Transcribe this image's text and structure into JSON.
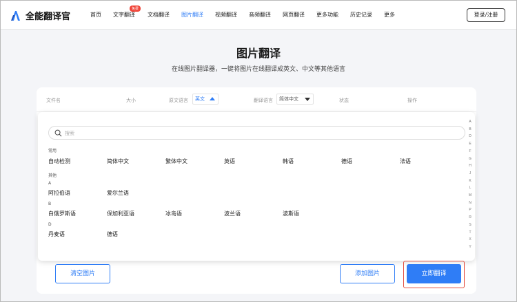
{
  "header": {
    "logo_text": "全能翻译官",
    "nav": [
      {
        "label": "首页",
        "active": false
      },
      {
        "label": "文字翻译",
        "active": false
      },
      {
        "label": "文档翻译",
        "active": false
      },
      {
        "label": "图片翻译",
        "active": true
      },
      {
        "label": "视频翻译",
        "active": false
      },
      {
        "label": "音频翻译",
        "active": false
      },
      {
        "label": "网页翻译",
        "active": false
      },
      {
        "label": "更多功能",
        "active": false
      },
      {
        "label": "历史记录",
        "active": false
      },
      {
        "label": "更多",
        "active": false
      }
    ],
    "free_badge": "免费",
    "login_label": "登录/注册"
  },
  "main": {
    "title": "图片翻译",
    "subtitle": "在线图片翻译器，一键将图片在线翻译成英文、中文等其他语言"
  },
  "table": {
    "col_filename": "文件名",
    "col_size": "大小",
    "col_source_lang": "原文语言",
    "source_lang_value": "英文",
    "col_target_lang": "翻译语言",
    "target_lang_value": "简体中文",
    "col_status": "状态",
    "col_action": "操作"
  },
  "dropdown": {
    "search_placeholder": "搜索",
    "groups": [
      {
        "label": "常用",
        "items": [
          "自动检测",
          "简体中文",
          "繁体中文",
          "英语",
          "韩语",
          "德语",
          "法语"
        ]
      },
      {
        "label": "其他",
        "items": []
      },
      {
        "label": "A",
        "items": [
          "阿拉伯语",
          "爱尔兰语"
        ]
      },
      {
        "label": "B",
        "items": [
          "白俄罗斯语",
          "保加利亚语",
          "冰岛语",
          "波兰语",
          "波斯语"
        ]
      },
      {
        "label": "D",
        "items": [
          "丹麦语",
          "德语"
        ]
      }
    ],
    "alphabet": [
      "A",
      "B",
      "D",
      "E",
      "F",
      "G",
      "H",
      "J",
      "K",
      "L",
      "M",
      "N",
      "P",
      "R",
      "S",
      "T",
      "X",
      "Y"
    ]
  },
  "buttons": {
    "clear": "清空图片",
    "add": "添加图片",
    "translate": "立即翻译"
  },
  "colors": {
    "accent": "#2f7df6",
    "highlight": "#e24a3b",
    "badge": "#f04438"
  }
}
